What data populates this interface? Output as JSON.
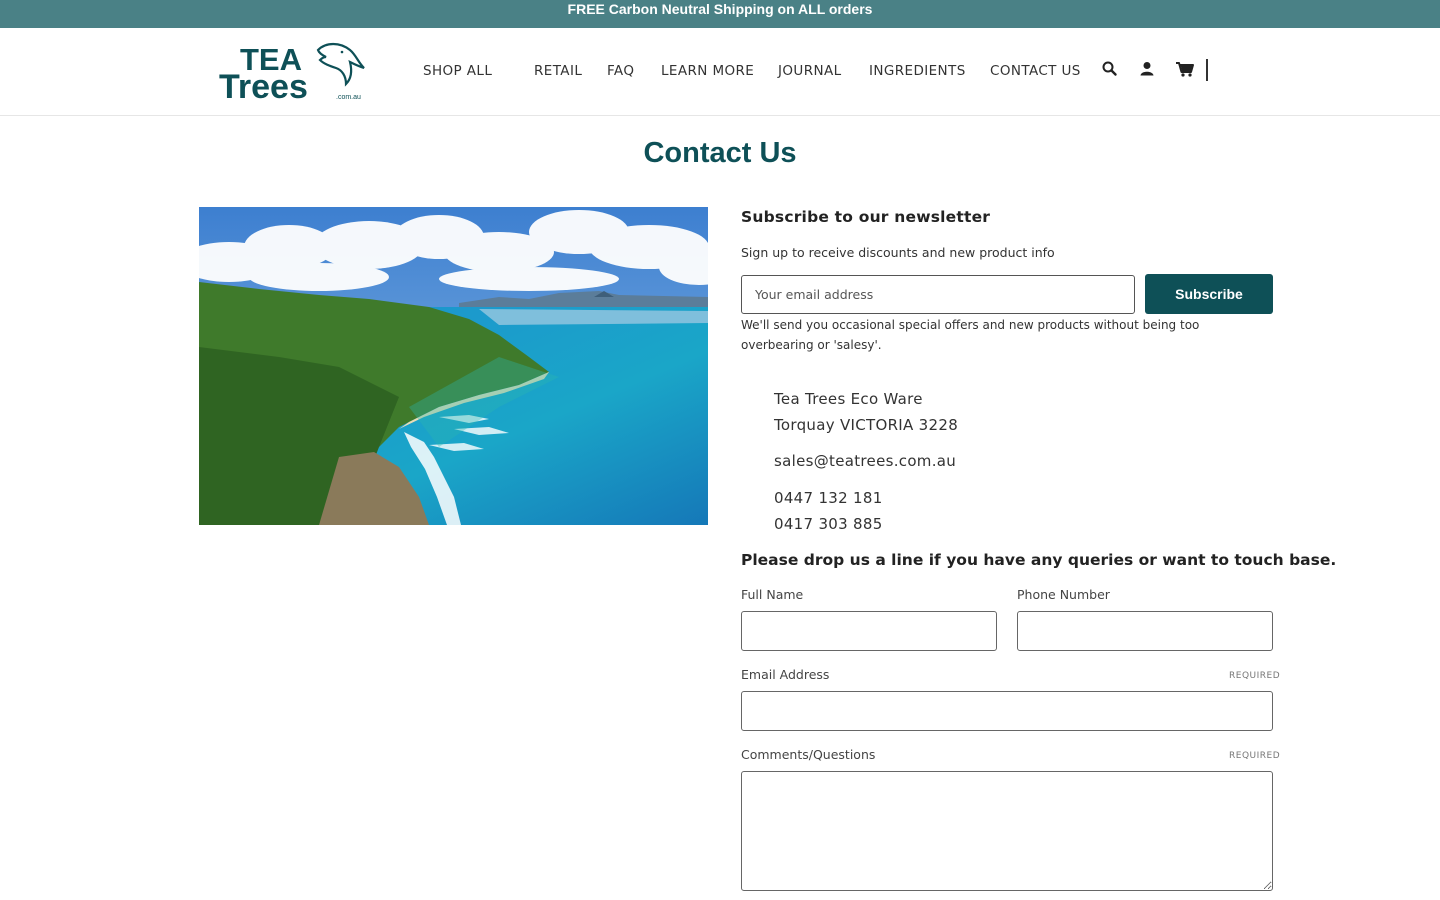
{
  "announcement": "FREE Carbon Neutral Shipping on ALL orders",
  "logo": {
    "line1": "TEA",
    "line2": "Trees",
    "suffix": ".com.au"
  },
  "nav": {
    "shop_all": "SHOP ALL",
    "retail": "RETAIL",
    "faq": "FAQ",
    "learn_more": "LEARN MORE",
    "journal": "JOURNAL",
    "ingredients": "INGREDIENTS",
    "contact_us": "CONTACT US"
  },
  "header_icons": [
    "search-icon",
    "account-icon",
    "cart-icon"
  ],
  "page_title": "Contact Us",
  "newsletter": {
    "title": "Subscribe to our newsletter",
    "description": "Sign up to receive discounts and new product info",
    "placeholder": "Your email address",
    "button": "Subscribe",
    "note": "We'll send you occasional special offers and new products without being too overbearing or 'salesy'."
  },
  "contact": {
    "company": "Tea Trees Eco Ware",
    "location": "Torquay VICTORIA 3228",
    "email": "sales@teatrees.com.au",
    "phone1": "0447 132 181",
    "phone2": "0417 303 885"
  },
  "form": {
    "intro": "Please drop us a line if you have any queries or want to touch base.",
    "full_name_label": "Full Name",
    "phone_label": "Phone Number",
    "email_label": "Email Address",
    "comments_label": "Comments/Questions",
    "required": "REQUIRED"
  },
  "colors": {
    "brand": "#0e5057",
    "announce_bar": "#4a8186"
  }
}
